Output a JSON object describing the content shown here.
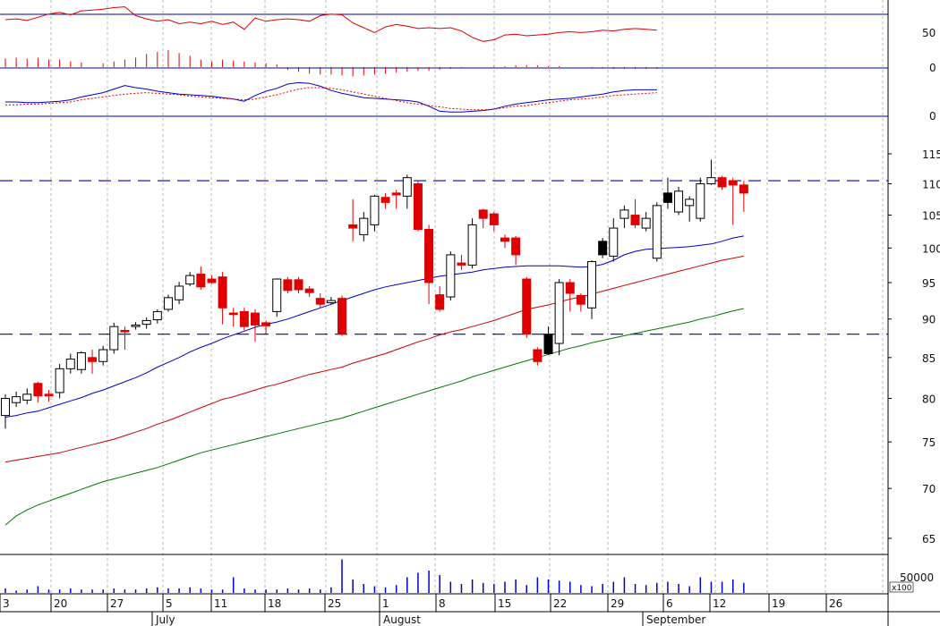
{
  "colors": {
    "up": "#000000",
    "down": "#e00000",
    "sma_short": "#0000cc",
    "sma_mid": "#cc0000",
    "sma_long": "#007700",
    "hline": "#0000aa",
    "grid": "#b8b8b8"
  },
  "chart_data": [
    {
      "type": "line",
      "title": "",
      "yticks": [
        50,
        0
      ],
      "ylim": [
        0,
        80
      ],
      "series": [
        {
          "values": [
            60,
            61,
            59,
            63,
            67,
            69,
            66,
            71,
            72,
            73,
            75,
            76,
            65,
            61,
            58,
            60,
            55,
            57,
            55,
            58,
            54,
            57,
            48,
            62,
            58,
            60,
            61,
            60,
            58,
            65,
            67,
            66,
            56,
            50,
            44,
            51,
            54,
            52,
            49,
            50,
            49,
            50,
            46,
            38,
            33,
            35,
            41,
            42,
            40,
            41,
            42,
            44,
            45,
            44,
            45,
            47,
            46,
            48,
            49,
            48,
            47
          ]
        },
        {
          "type": "bar",
          "values": [
            9,
            10,
            9,
            10,
            8,
            8,
            6,
            5,
            0,
            4,
            6,
            8,
            10,
            14,
            16,
            18,
            15,
            12,
            8,
            6,
            8,
            7,
            6,
            5,
            4,
            3,
            -3,
            -5,
            -7,
            -8,
            -8,
            -9,
            -10,
            -9,
            -8,
            -7,
            -6,
            -5,
            -4,
            -4,
            -3,
            -2,
            -1,
            0,
            0,
            1,
            1,
            2,
            2,
            2,
            1,
            1,
            0,
            0,
            -1,
            -1,
            -2,
            -2,
            -2,
            -2,
            -2
          ]
        }
      ]
    },
    {
      "type": "line",
      "title": "",
      "yticks": [
        0
      ],
      "ylim": [
        -1,
        4
      ],
      "series": [
        {
          "values": [
            0.6,
            0.6,
            0.55,
            0.55,
            0.6,
            0.65,
            0.75,
            0.95,
            1.1,
            1.25,
            1.5,
            1.75,
            1.6,
            1.5,
            1.35,
            1.25,
            1.15,
            1.1,
            1.05,
            1.0,
            0.9,
            0.8,
            0.65,
            1.05,
            1.35,
            1.55,
            1.85,
            1.95,
            1.9,
            1.7,
            1.4,
            1.2,
            1.05,
            0.9,
            0.85,
            0.8,
            0.75,
            0.7,
            0.6,
            0.3,
            -0.05,
            -0.1,
            -0.1,
            -0.05,
            0.0,
            0.1,
            0.3,
            0.45,
            0.55,
            0.65,
            0.75,
            0.8,
            0.85,
            0.95,
            1.05,
            1.15,
            1.3,
            1.4,
            1.45,
            1.45,
            1.45
          ]
        },
        {
          "values": [
            0.4,
            0.4,
            0.45,
            0.45,
            0.5,
            0.55,
            0.6,
            0.75,
            0.85,
            0.95,
            1.05,
            1.15,
            1.2,
            1.25,
            1.2,
            1.15,
            1.1,
            1.0,
            0.95,
            0.9,
            0.85,
            0.8,
            0.75,
            0.8,
            0.95,
            1.1,
            1.3,
            1.5,
            1.6,
            1.6,
            1.55,
            1.45,
            1.3,
            1.15,
            1.0,
            0.85,
            0.7,
            0.55,
            0.45,
            0.35,
            0.25,
            0.15,
            0.1,
            0.05,
            0.05,
            0.1,
            0.2,
            0.3,
            0.35,
            0.45,
            0.55,
            0.65,
            0.75,
            0.8,
            0.85,
            0.95,
            1.05,
            1.1,
            1.15,
            1.2,
            1.25
          ]
        }
      ]
    },
    {
      "type": "candlestick",
      "title": "",
      "yticks": [
        65,
        70,
        75,
        80,
        85,
        90,
        95,
        100,
        105,
        110,
        115
      ],
      "ylim": [
        62,
        119
      ],
      "hlines": [
        110.5,
        88
      ],
      "x_day_labels": [
        "3",
        "20",
        "27",
        "5",
        "11",
        "18",
        "25",
        "1",
        "8",
        "15",
        "22",
        "29",
        "6",
        "12",
        "19",
        "26"
      ],
      "month_labels": [
        "July",
        "August",
        "September"
      ],
      "candles": [
        [
          78.0,
          80.0,
          76.5,
          80.5
        ],
        [
          79.5,
          80.2,
          79.0,
          80.8
        ],
        [
          79.8,
          80.5,
          79.3,
          81.2
        ],
        [
          81.8,
          80.3,
          79.5,
          82.0
        ],
        [
          80.5,
          80.3,
          79.6,
          81.0
        ],
        [
          80.7,
          83.6,
          80.0,
          84.2
        ],
        [
          83.6,
          84.8,
          83.0,
          85.5
        ],
        [
          83.5,
          85.6,
          83.0,
          85.8
        ],
        [
          85.0,
          84.5,
          83.0,
          86.0
        ],
        [
          84.5,
          86.0,
          84.0,
          86.5
        ],
        [
          86.0,
          89.0,
          85.5,
          89.5
        ],
        [
          88.5,
          88.3,
          86.0,
          89.0
        ],
        [
          89.0,
          89.2,
          88.6,
          89.6
        ],
        [
          89.3,
          89.8,
          88.7,
          90.2
        ],
        [
          89.9,
          91.0,
          89.4,
          91.3
        ],
        [
          91.3,
          92.9,
          91.0,
          93.3
        ],
        [
          92.6,
          94.5,
          92.0,
          95.1
        ],
        [
          94.8,
          96.0,
          94.5,
          96.5
        ],
        [
          96.2,
          94.4,
          94.0,
          97.3
        ],
        [
          95.5,
          95.0,
          94.8,
          96.0
        ],
        [
          95.8,
          91.5,
          89.3,
          96.5
        ],
        [
          90.8,
          90.6,
          89.0,
          91.5
        ],
        [
          91.0,
          89.0,
          88.5,
          91.5
        ],
        [
          90.8,
          89.2,
          87.0,
          91.3
        ],
        [
          89.5,
          89.1,
          88.0,
          89.8
        ],
        [
          91.0,
          95.5,
          90.3,
          95.6
        ],
        [
          95.4,
          93.9,
          93.5,
          95.8
        ],
        [
          95.4,
          94.0,
          93.5,
          95.8
        ],
        [
          94.1,
          93.6,
          93.0,
          94.5
        ],
        [
          92.8,
          92.0,
          91.5,
          93.5
        ],
        [
          92.2,
          92.5,
          92.0,
          93.0
        ],
        [
          92.8,
          88.0,
          87.8,
          93.2
        ],
        [
          103.5,
          103.0,
          101.0,
          107.5
        ],
        [
          102.0,
          104.5,
          101.0,
          105.5
        ],
        [
          103.5,
          108.0,
          102.5,
          108.2
        ],
        [
          107.8,
          107.0,
          106.0,
          108.5
        ],
        [
          108.5,
          108.2,
          106.0,
          109.0
        ],
        [
          108.0,
          111.0,
          106.0,
          111.5
        ],
        [
          110.0,
          102.8,
          102.5,
          110.5
        ],
        [
          102.8,
          95.0,
          92.0,
          103.5
        ],
        [
          93.3,
          91.3,
          91.0,
          94.5
        ],
        [
          93.0,
          99.0,
          92.5,
          99.5
        ],
        [
          97.8,
          97.5,
          96.8,
          99.0
        ],
        [
          97.5,
          103.5,
          97.0,
          104.5
        ],
        [
          105.8,
          104.5,
          103.0,
          106.0
        ],
        [
          105.2,
          103.5,
          102.5,
          105.5
        ],
        [
          101.5,
          101.0,
          100.0,
          102.0
        ],
        [
          101.5,
          99.0,
          97.5,
          101.8
        ],
        [
          95.5,
          88.0,
          87.5,
          95.8
        ],
        [
          86.0,
          84.5,
          84.0,
          86.3
        ],
        [
          85.5,
          88.0,
          85.3,
          89.0
        ],
        [
          86.8,
          95.0,
          85.3,
          95.5
        ],
        [
          95.0,
          93.5,
          91.0,
          95.5
        ],
        [
          93.2,
          92.0,
          91.0,
          93.5
        ],
        [
          91.5,
          98.0,
          90.0,
          98.2
        ],
        [
          99.0,
          101.0,
          98.5,
          101.5
        ],
        [
          98.8,
          103.0,
          98.0,
          104.5
        ],
        [
          104.5,
          105.8,
          103.0,
          106.5
        ],
        [
          105.0,
          103.5,
          103.0,
          107.5
        ],
        [
          103.0,
          104.5,
          102.5,
          105.5
        ],
        [
          98.5,
          106.5,
          98.0,
          107.0
        ],
        [
          107.0,
          108.5,
          106.0,
          111.0
        ],
        [
          105.5,
          108.8,
          105.0,
          109.5
        ],
        [
          106.5,
          107.5,
          104.0,
          108.0
        ],
        [
          104.5,
          110.0,
          104.0,
          111.0
        ],
        [
          110.0,
          111.0,
          109.8,
          114.0
        ],
        [
          111.0,
          109.5,
          109.0,
          111.3
        ],
        [
          110.5,
          109.8,
          103.5,
          111.0
        ],
        [
          109.8,
          108.5,
          105.5,
          110.5
        ]
      ],
      "sma_short": [
        77.8,
        78.0,
        78.3,
        78.5,
        78.9,
        79.3,
        79.7,
        80.1,
        80.6,
        81.0,
        81.5,
        82.0,
        82.5,
        83.1,
        83.8,
        84.4,
        85.0,
        85.7,
        86.3,
        86.8,
        87.4,
        87.9,
        88.4,
        88.9,
        89.3,
        89.6,
        90.0,
        90.5,
        91.0,
        91.5,
        92.0,
        92.5,
        93.0,
        93.5,
        94.0,
        94.4,
        94.7,
        95.0,
        95.3,
        95.6,
        95.9,
        96.1,
        96.3,
        96.5,
        96.8,
        97.0,
        97.2,
        97.3,
        97.4,
        97.4,
        97.4,
        97.4,
        97.3,
        97.2,
        97.3,
        97.6,
        98.2,
        99.0,
        99.5,
        99.8,
        99.9,
        100.0,
        100.1,
        100.2,
        100.4,
        100.6,
        101.0,
        101.5,
        101.8
      ],
      "sma_mid": [
        72.8,
        73.0,
        73.2,
        73.4,
        73.6,
        73.8,
        74.1,
        74.4,
        74.7,
        75.0,
        75.3,
        75.7,
        76.1,
        76.5,
        77.0,
        77.4,
        77.9,
        78.4,
        78.9,
        79.4,
        79.9,
        80.2,
        80.6,
        81.0,
        81.4,
        81.7,
        82.1,
        82.5,
        82.9,
        83.2,
        83.5,
        83.8,
        84.3,
        84.7,
        85.1,
        85.5,
        86.0,
        86.5,
        87.0,
        87.4,
        87.9,
        88.3,
        88.6,
        89.0,
        89.4,
        89.8,
        90.3,
        90.8,
        91.3,
        91.6,
        91.9,
        92.3,
        92.7,
        93.0,
        93.4,
        93.8,
        94.2,
        94.6,
        95.0,
        95.4,
        95.8,
        96.2,
        96.6,
        97.0,
        97.4,
        97.8,
        98.2,
        98.5,
        98.8
      ],
      "sma_long": [
        66.3,
        67.2,
        67.8,
        68.3,
        68.7,
        69.1,
        69.5,
        69.9,
        70.3,
        70.7,
        71.0,
        71.3,
        71.6,
        71.9,
        72.2,
        72.6,
        73.0,
        73.4,
        73.8,
        74.1,
        74.4,
        74.7,
        75.0,
        75.3,
        75.6,
        75.9,
        76.2,
        76.5,
        76.8,
        77.1,
        77.4,
        77.7,
        78.1,
        78.5,
        78.9,
        79.3,
        79.7,
        80.1,
        80.5,
        80.9,
        81.3,
        81.7,
        82.1,
        82.6,
        83.0,
        83.4,
        83.8,
        84.2,
        84.6,
        85.0,
        85.4,
        85.8,
        86.2,
        86.5,
        86.9,
        87.2,
        87.5,
        87.8,
        88.1,
        88.4,
        88.7,
        89.0,
        89.3,
        89.6,
        90.0,
        90.3,
        90.7,
        91.1,
        91.4
      ]
    },
    {
      "type": "bar",
      "title": "",
      "yticks": [
        50000
      ],
      "unit_label": "x100",
      "values": [
        4,
        2,
        3,
        6,
        3,
        3,
        4,
        3,
        3,
        3,
        4,
        3,
        3,
        4,
        5,
        4,
        4,
        5,
        4,
        3,
        3,
        14,
        4,
        3,
        3,
        3,
        4,
        3,
        4,
        3,
        5,
        30,
        12,
        8,
        6,
        5,
        7,
        14,
        18,
        20,
        16,
        10,
        8,
        12,
        9,
        8,
        10,
        12,
        7,
        14,
        12,
        11,
        10,
        7,
        6,
        8,
        10,
        14,
        8,
        7,
        9,
        10,
        8,
        6,
        14,
        10,
        10,
        12,
        9
      ]
    }
  ]
}
